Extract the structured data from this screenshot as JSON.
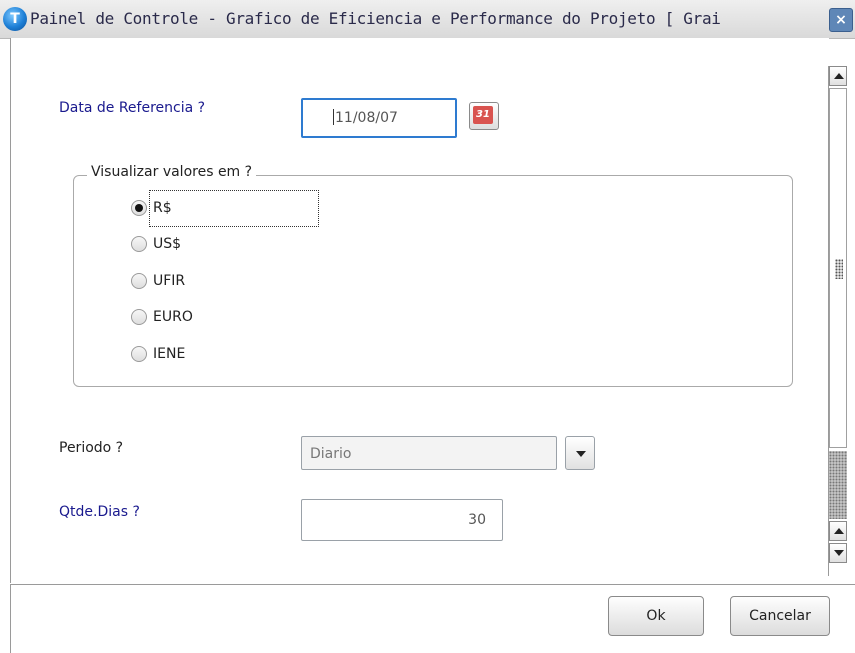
{
  "window": {
    "title": "Painel de Controle - Grafico de Eficiencia e Performance do Projeto [ Grai",
    "logo_letter": "T",
    "close_glyph": "×"
  },
  "form": {
    "data_referencia": {
      "label": "Data de Referencia ?",
      "value": "11/08/07",
      "calendar_icon": "31"
    },
    "visualizar": {
      "title": "Visualizar valores em  ?",
      "options": [
        "R$",
        "US$",
        "UFIR",
        "EURO",
        "IENE"
      ],
      "selected": "R$"
    },
    "periodo": {
      "label": "Periodo ?",
      "value": "Diario"
    },
    "qtde_dias": {
      "label": "Qtde.Dias ?",
      "value": "30"
    }
  },
  "buttons": {
    "ok": "Ok",
    "cancel": "Cancelar"
  },
  "colors": {
    "accent_label": "#1a1a8e",
    "focus_border": "#2e7bd0"
  }
}
